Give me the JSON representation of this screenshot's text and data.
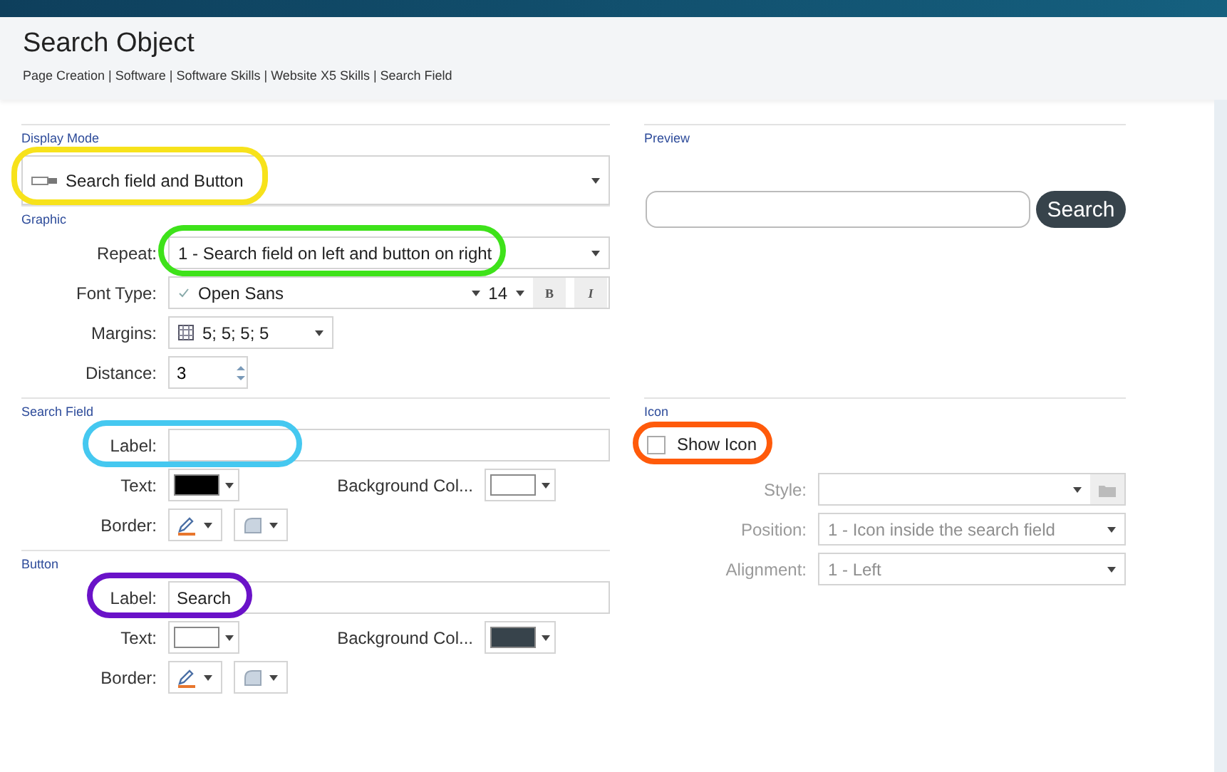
{
  "header": {
    "title": "Search Object",
    "breadcrumb": "Page Creation | Software | Software Skills | Website X5 Skills | Search Field"
  },
  "display_mode": {
    "heading": "Display Mode",
    "value": "Search field and Button"
  },
  "graphic": {
    "heading": "Graphic",
    "repeat": {
      "label": "Repeat:",
      "value": "1 - Search field on left and button on right"
    },
    "font": {
      "label": "Font Type:",
      "value": "Open Sans",
      "size": "14",
      "bold": "B",
      "italic": "I"
    },
    "margins": {
      "label": "Margins:",
      "value": "5; 5; 5; 5"
    },
    "distance": {
      "label": "Distance:",
      "value": "3"
    }
  },
  "search_field": {
    "heading": "Search Field",
    "label": {
      "label": "Label:"
    },
    "text_color": {
      "label": "Text:",
      "color": "#000000"
    },
    "background_color": {
      "label": "Background Col...",
      "color": "#ffffff"
    },
    "border": {
      "label": "Border:"
    }
  },
  "button": {
    "heading": "Button",
    "label": {
      "label": "Label:",
      "value": "Search"
    },
    "text_color": {
      "label": "Text:",
      "color": "#ffffff"
    },
    "background_color": {
      "label": "Background Col...",
      "color": "#37434b"
    },
    "border": {
      "label": "Border:"
    }
  },
  "preview": {
    "heading": "Preview",
    "button": "Search"
  },
  "icon": {
    "heading": "Icon",
    "show_icon": {
      "label": "Show Icon",
      "checked": false
    },
    "rows": [
      {
        "label": "Style:",
        "disabled": true
      },
      {
        "label": "Position:",
        "value": "1 - Icon inside the search field",
        "disabled": true
      },
      {
        "label": "Alignment:",
        "value": "1 - Left",
        "disabled": true
      }
    ]
  },
  "annotations": [
    {
      "color": "#f7e21b"
    },
    {
      "color": "#3ee21a"
    },
    {
      "color": "#45c8f0"
    },
    {
      "color": "#ff5a0a"
    },
    {
      "color": "#6a12c8"
    }
  ]
}
